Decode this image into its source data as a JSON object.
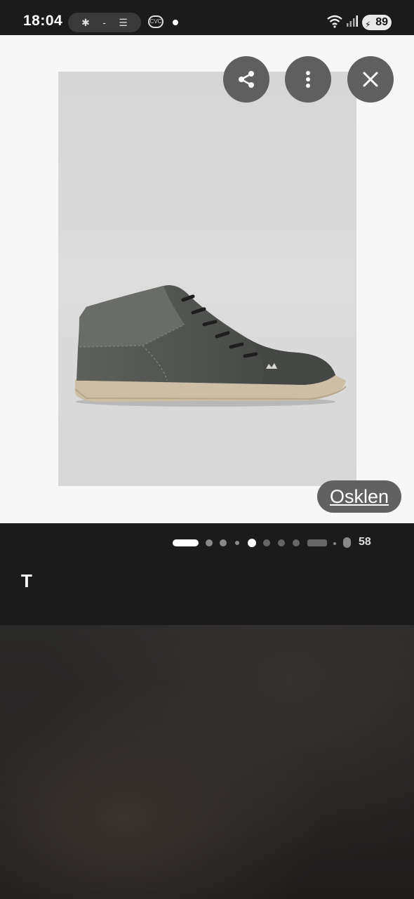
{
  "status_bar": {
    "time": "18:04",
    "battery": "89",
    "pill_icons": [
      "bug-icon",
      "minus-icon",
      "flag-icon"
    ],
    "cvc_label": "CVC"
  },
  "viewer": {
    "source_label": "Osklen",
    "product": "Grey high-top suede sneaker"
  },
  "pager": {
    "counter": "58"
  },
  "bottom": {
    "text_tool": "T"
  }
}
